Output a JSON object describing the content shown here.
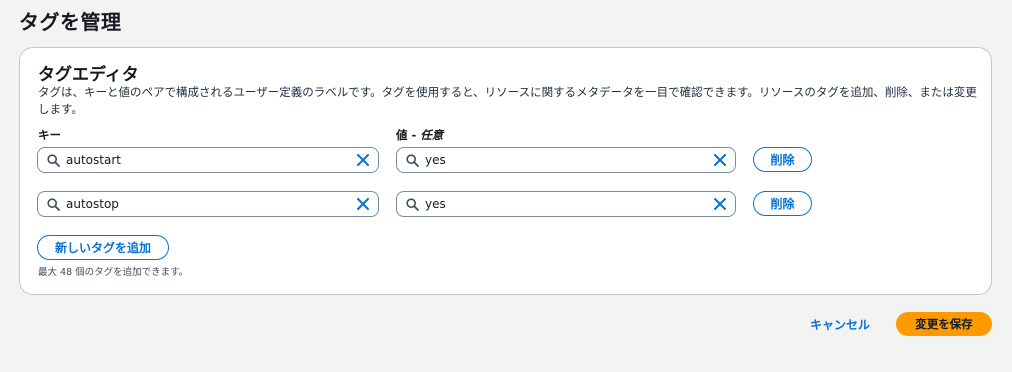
{
  "page": {
    "title": "タグを管理"
  },
  "editor": {
    "title": "タグエディタ",
    "description": "タグは、キーと値のペアで構成されるユーザー定義のラベルです。タグを使用すると、リソースに関するメタデータを一目で確認できます。リソースのタグを追加、削除、または変更します。",
    "key_label": "キー",
    "value_label": "値 - ",
    "value_optional": "任意",
    "rows": [
      {
        "key": "autostart",
        "value": "yes",
        "remove_label": "削除"
      },
      {
        "key": "autostop",
        "value": "yes",
        "remove_label": "削除"
      }
    ],
    "add_label": "新しいタグを追加",
    "limit_hint": "最大 48 個のタグを追加できます。"
  },
  "footer": {
    "cancel_label": "キャンセル",
    "save_label": "変更を保存"
  },
  "colors": {
    "accent": "#0972d3",
    "primary_button": "#ff9900",
    "background": "#f2f3f3"
  },
  "icons": [
    "search-icon",
    "close-icon"
  ]
}
